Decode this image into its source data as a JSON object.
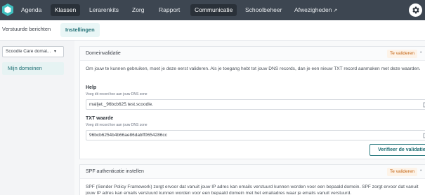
{
  "nav": {
    "items": [
      "Agenda",
      "Klassen",
      "Lerarenkits",
      "Zorg",
      "Rapport",
      "Communicatie",
      "Schoolbeheer",
      "Afwezigheden"
    ],
    "active": [
      "Klassen",
      "Communicatie"
    ],
    "external_icon": "external-link-icon",
    "settings_icon": "gear-icon"
  },
  "subtabs": {
    "sent": "Verstuurde berichten",
    "settings": "Instellingen",
    "active": "Instellingen"
  },
  "sidebar": {
    "select_value": "Scoodle Care domai...",
    "domains_label": "Mijn domeinen"
  },
  "domain_validation": {
    "title": "Domeinvalidatie",
    "status": "Te valideren",
    "description": "Om jouw te kunnen gebruiken, moet je deze eerst valideren. Als je toegang hebt tot jouw DNS records, dan je een nieuw TXT record aanmaken met deze waarden.",
    "help_label": "Help",
    "help_hint": "Voeg dit record toe aan jouw DNS zone",
    "help_value": "mailjet._96bcb625.test.scoodle.",
    "txt_label": "TXT waarde",
    "txt_hint": "Voeg dit record toe aan jouw DNS zone",
    "txt_value": "96bcb6254b4b66ae86dabff0654286cc",
    "verify_button": "Verifieer de validatie"
  },
  "spf": {
    "title": "SPF authenticatie instellen",
    "status": "Te valideren",
    "description": "SPF (Sender Policy Framework) zorgt ervoor dat vanuit jouw IP adres kan emails verstuurd kunnen worden voor een bepaald domein. SPF zorgt ervoor dat vanuit jouw IP adres kan emails verstuurd kunnen worden voor een bepaald domein met het emailadres waar je emails vanuit verstuurd."
  },
  "colors": {
    "nav_bg": "#3d4651",
    "accent": "#2f7d82",
    "badge": "#c2620f"
  }
}
